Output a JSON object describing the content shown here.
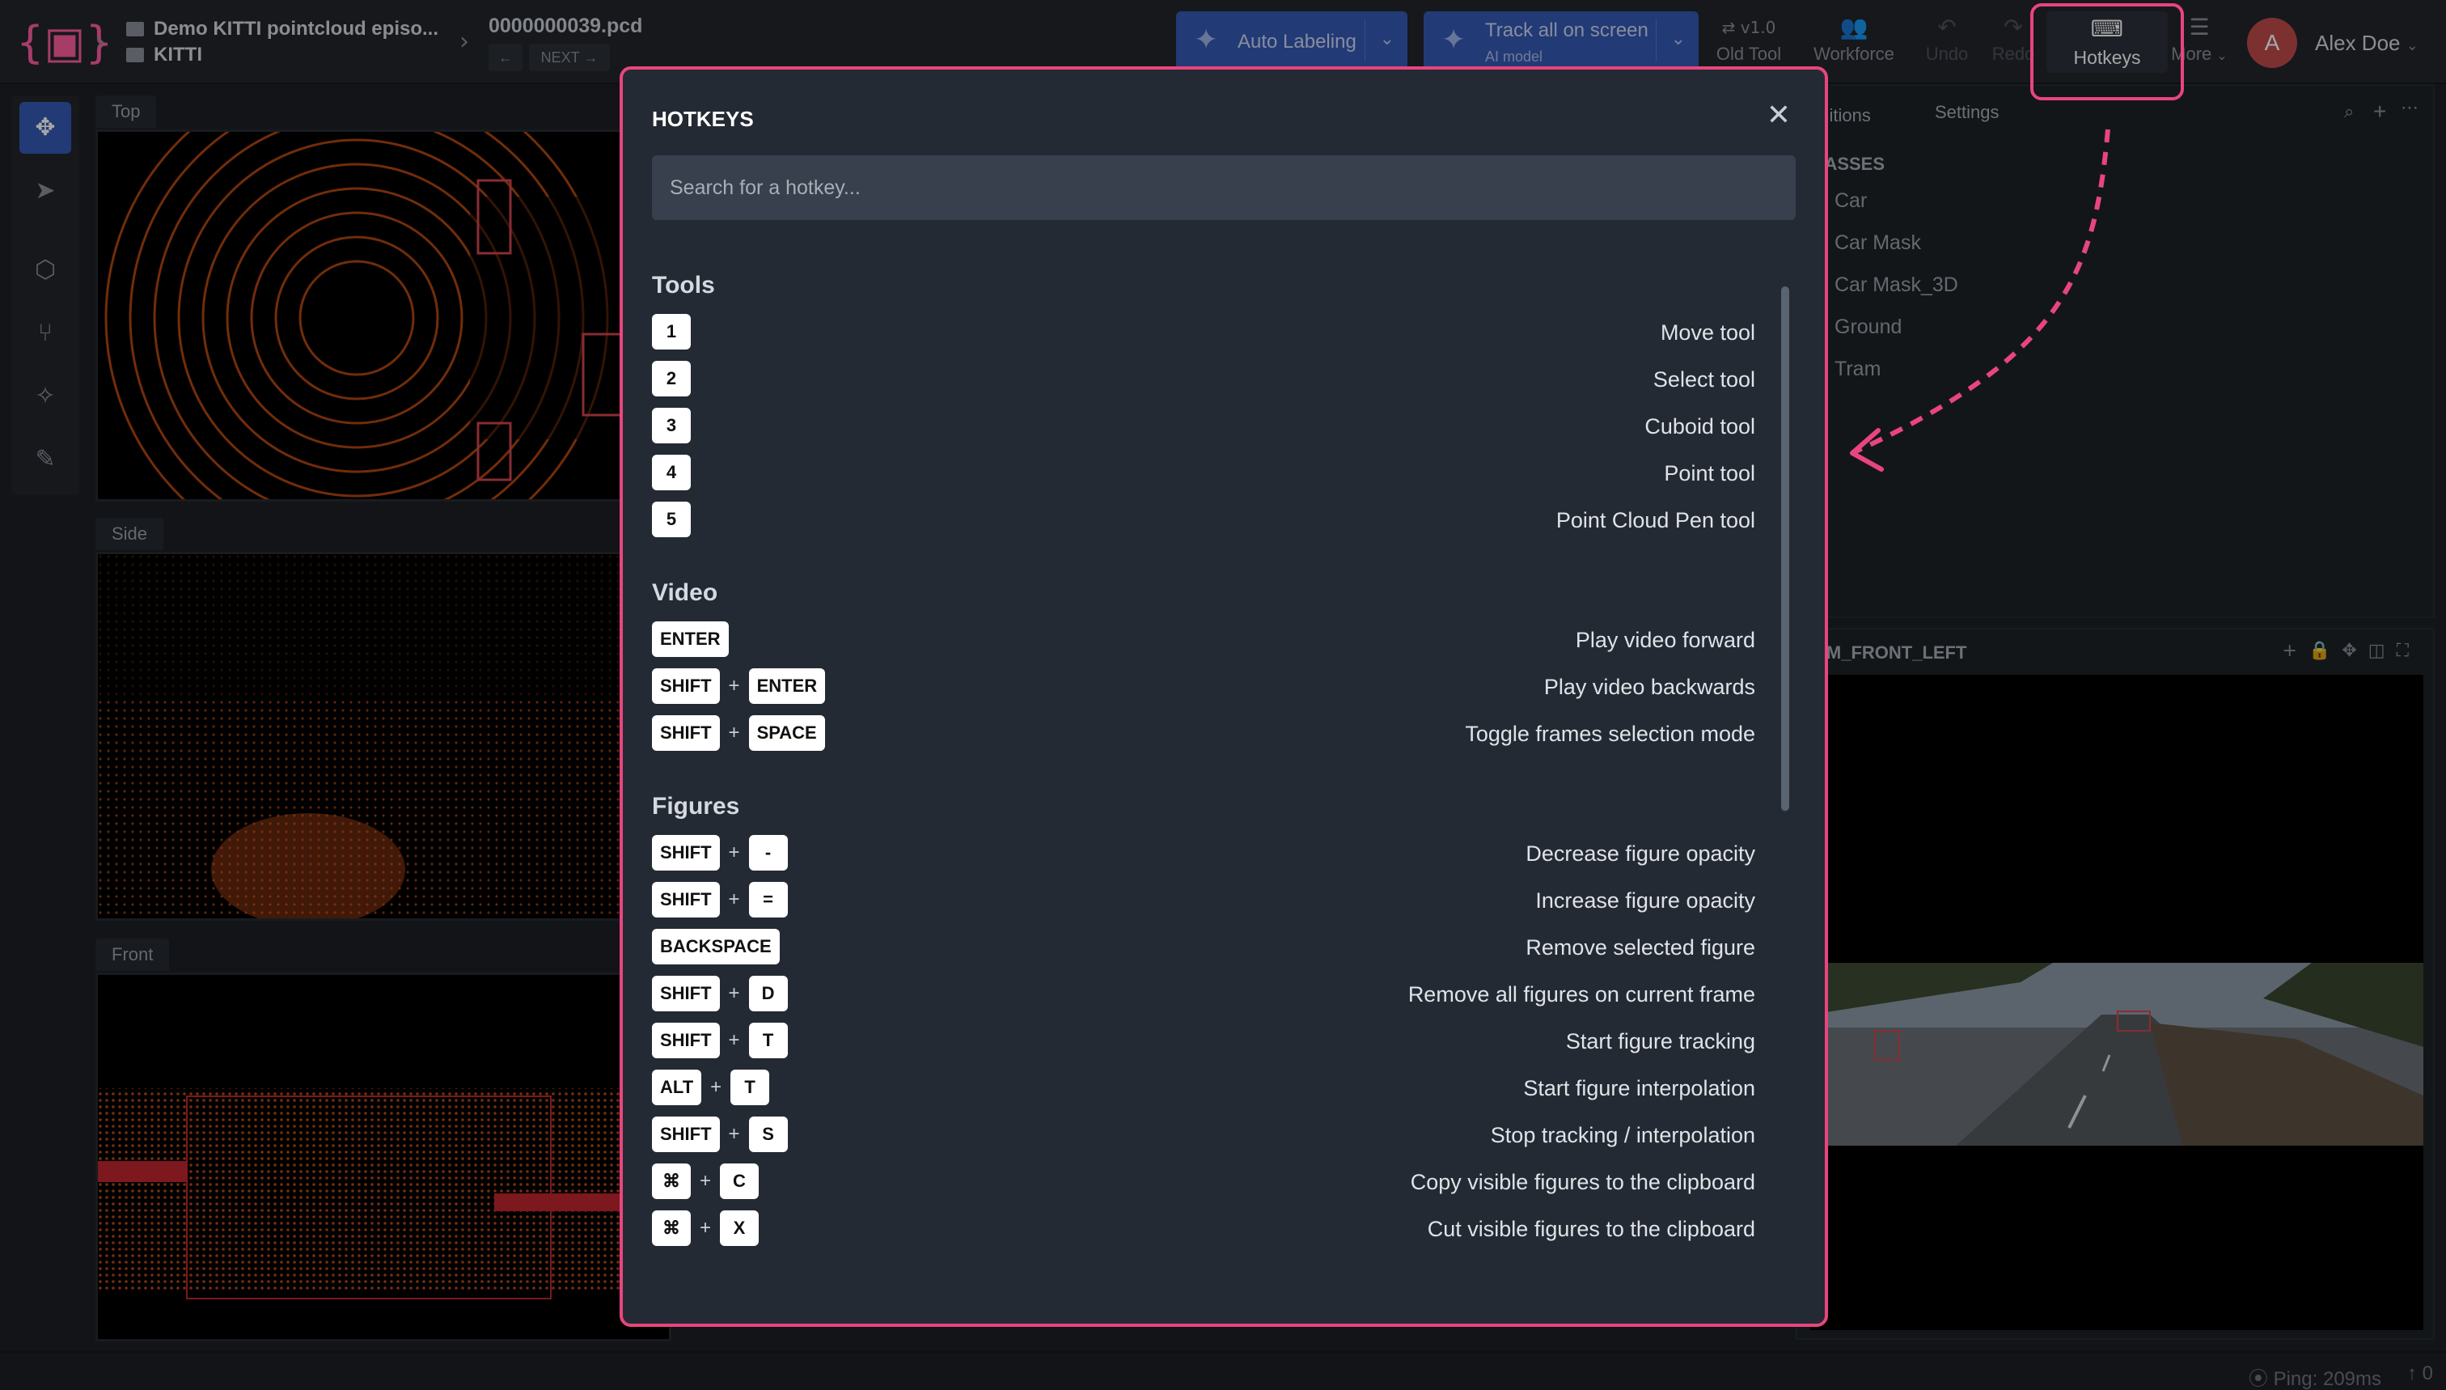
{
  "topbar": {
    "breadcrumb_project": "Demo KITTI pointcloud episo...",
    "breadcrumb_dataset": "KITTI",
    "file_name": "0000000039.pcd",
    "prev_label": "←",
    "next_label": "NEXT →",
    "auto_labeling": "Auto Labeling",
    "track_all": "Track all on screen",
    "track_all_sub": "AI model",
    "old_tool_version": "v1.0",
    "old_tool": "Old Tool",
    "workforce": "Workforce",
    "undo": "Undo",
    "redo": "Redo",
    "hotkeys": "Hotkeys",
    "more": "More",
    "user_initial": "A",
    "user_name": "Alex Doe"
  },
  "viewports": {
    "top": "Top",
    "side": "Side",
    "front": "Front"
  },
  "right_panel": {
    "tab_definitions": "efinitions",
    "tab_settings": "Settings",
    "classes_heading": "LASSES",
    "classes": [
      {
        "name": "Car"
      },
      {
        "name": "Car Mask"
      },
      {
        "name": "Car Mask_3D"
      },
      {
        "name": "Ground"
      },
      {
        "name": "Tram"
      }
    ],
    "camera_label": "AM_FRONT_LEFT"
  },
  "status": {
    "ping": "Ping: 209ms",
    "uploads": "0"
  },
  "modal": {
    "title": "HOTKEYS",
    "search_placeholder": "Search for a hotkey...",
    "sections": [
      {
        "title": "Tools",
        "items": [
          {
            "keys": [
              "1"
            ],
            "desc": "Move tool"
          },
          {
            "keys": [
              "2"
            ],
            "desc": "Select tool"
          },
          {
            "keys": [
              "3"
            ],
            "desc": "Cuboid tool"
          },
          {
            "keys": [
              "4"
            ],
            "desc": "Point tool"
          },
          {
            "keys": [
              "5"
            ],
            "desc": "Point Cloud Pen tool"
          }
        ]
      },
      {
        "title": "Video",
        "items": [
          {
            "keys": [
              "ENTER"
            ],
            "desc": "Play video forward"
          },
          {
            "keys": [
              "SHIFT",
              "ENTER"
            ],
            "desc": "Play video backwards"
          },
          {
            "keys": [
              "SHIFT",
              "SPACE"
            ],
            "desc": "Toggle frames selection mode"
          }
        ]
      },
      {
        "title": "Figures",
        "items": [
          {
            "keys": [
              "SHIFT",
              "-"
            ],
            "desc": "Decrease figure opacity"
          },
          {
            "keys": [
              "SHIFT",
              "="
            ],
            "desc": "Increase figure opacity"
          },
          {
            "keys": [
              "BACKSPACE"
            ],
            "desc": "Remove selected figure"
          },
          {
            "keys": [
              "SHIFT",
              "D"
            ],
            "desc": "Remove all figures on current frame"
          },
          {
            "keys": [
              "SHIFT",
              "T"
            ],
            "desc": "Start figure tracking"
          },
          {
            "keys": [
              "ALT",
              "T"
            ],
            "desc": "Start figure interpolation"
          },
          {
            "keys": [
              "SHIFT",
              "S"
            ],
            "desc": "Stop tracking / interpolation"
          },
          {
            "keys": [
              "⌘",
              "C"
            ],
            "desc": "Copy visible figures to the clipboard"
          },
          {
            "keys": [
              "⌘",
              "X"
            ],
            "desc": "Cut visible figures to the clipboard"
          }
        ]
      }
    ]
  },
  "colors": {
    "accent_pink": "#e8457f",
    "accent_blue": "#3559b4",
    "pointcloud": "#e0561c"
  }
}
